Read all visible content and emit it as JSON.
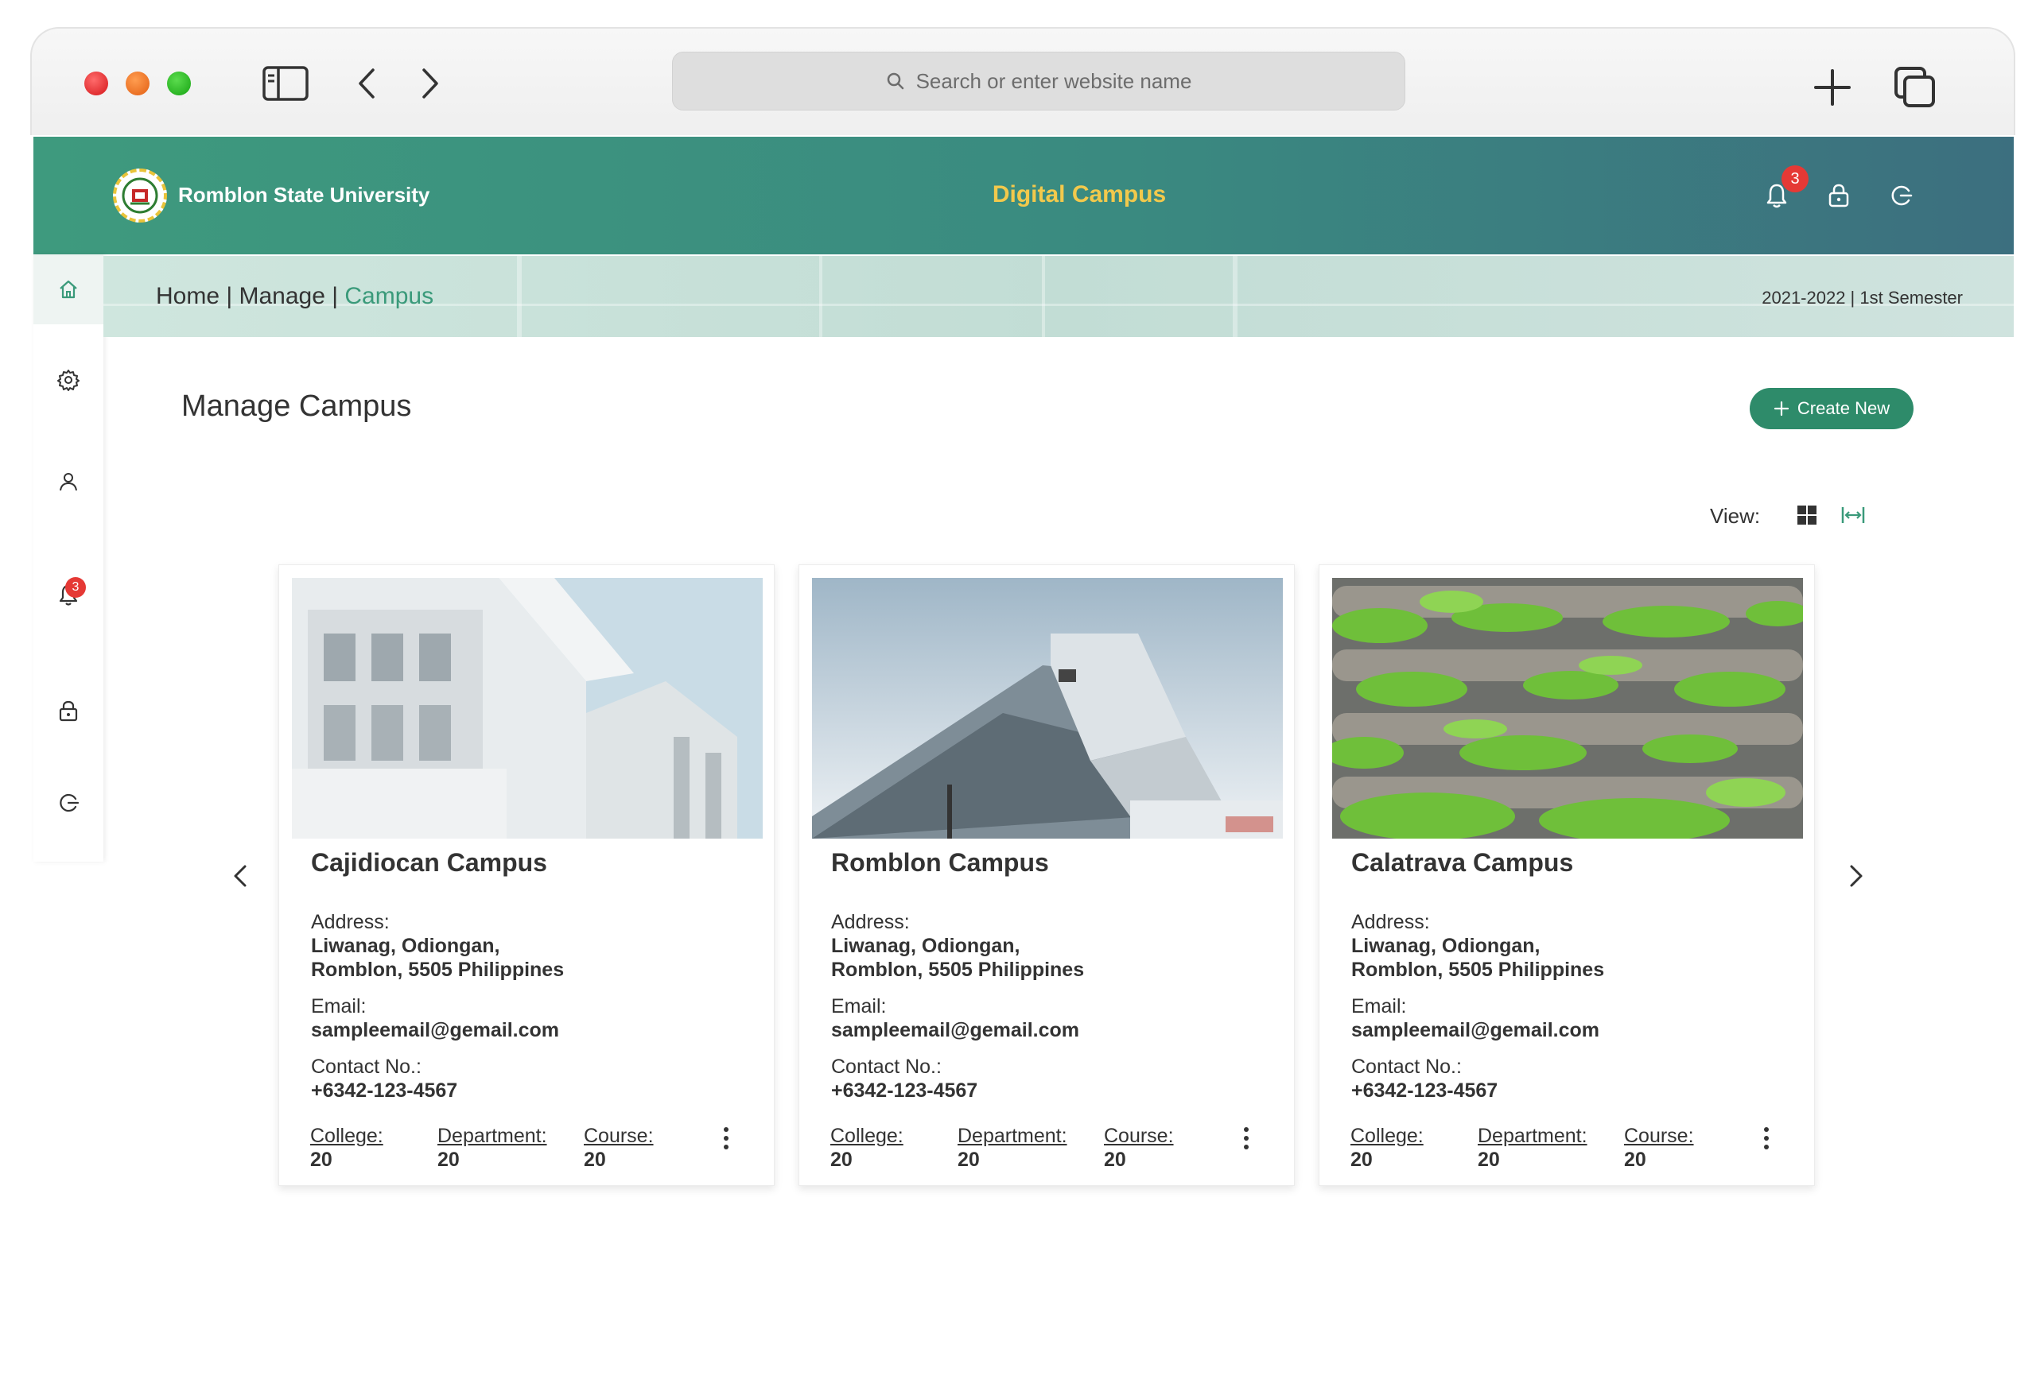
{
  "browser": {
    "address_placeholder": "Search or enter website name"
  },
  "header": {
    "university_name": "Romblon State University",
    "app_title": "Digital Campus",
    "notification_count": "3"
  },
  "sidebar": {
    "notification_count": "3"
  },
  "breadcrumb": {
    "home": "Home",
    "sep1": " | ",
    "manage": "Manage",
    "sep2": " | ",
    "current": "Campus"
  },
  "semester": "2021-2022 | 1st Semester",
  "main": {
    "title": "Manage Campus",
    "create_label": "Create New",
    "view_label": "View:"
  },
  "campuses": [
    {
      "name": "Cajidiocan Campus",
      "address_label": "Address:",
      "address_line1": "Liwanag, Odiongan,",
      "address_line2": "Romblon, 5505 Philippines",
      "email_label": "Email:",
      "email": "sampleemail@gemail.com",
      "contact_label": "Contact No.:",
      "contact": "+6342-123-4567",
      "college_label": "College:",
      "college": "20",
      "department_label": "Department:",
      "department": "20",
      "course_label": "Course:",
      "course": "20"
    },
    {
      "name": "Romblon Campus",
      "address_label": "Address:",
      "address_line1": "Liwanag, Odiongan,",
      "address_line2": "Romblon, 5505 Philippines",
      "email_label": "Email:",
      "email": "sampleemail@gemail.com",
      "contact_label": "Contact No.:",
      "contact": "+6342-123-4567",
      "college_label": "College:",
      "college": "20",
      "department_label": "Department:",
      "department": "20",
      "course_label": "Course:",
      "course": "20"
    },
    {
      "name": "Calatrava Campus",
      "address_label": "Address:",
      "address_line1": "Liwanag, Odiongan,",
      "address_line2": "Romblon, 5505 Philippines",
      "email_label": "Email:",
      "email": "sampleemail@gemail.com",
      "contact_label": "Contact No.:",
      "contact": "+6342-123-4567",
      "college_label": "College:",
      "college": "20",
      "department_label": "Department:",
      "department": "20",
      "course_label": "Course:",
      "course": "20"
    }
  ],
  "colors": {
    "brand_green": "#2e8b6a",
    "header_start": "#3e9a7e",
    "header_end": "#3c6f7f",
    "title_gold": "#f2c94c",
    "badge_red": "#e53935",
    "breadcrumb_active": "#3a9a7a"
  },
  "icons": {
    "sidebar": [
      "home-icon",
      "gear-icon",
      "user-icon",
      "bell-icon",
      "lock-icon",
      "logout-icon"
    ],
    "header": [
      "bell-icon",
      "lock-icon",
      "logout-icon"
    ]
  }
}
